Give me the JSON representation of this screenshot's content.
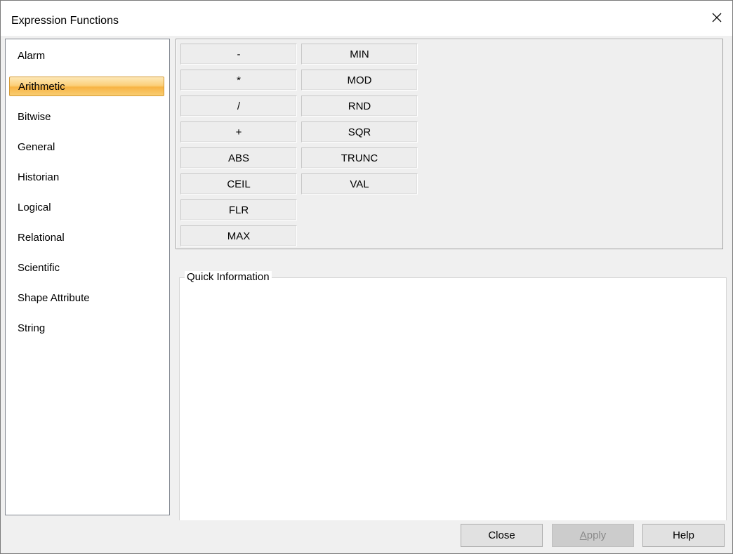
{
  "window": {
    "title": "Expression Functions",
    "close_icon": "close-icon"
  },
  "categories": {
    "items": [
      {
        "label": "Alarm",
        "selected": false
      },
      {
        "label": "Arithmetic",
        "selected": true
      },
      {
        "label": "Bitwise",
        "selected": false
      },
      {
        "label": "General",
        "selected": false
      },
      {
        "label": "Historian",
        "selected": false
      },
      {
        "label": "Logical",
        "selected": false
      },
      {
        "label": "Relational",
        "selected": false
      },
      {
        "label": "Scientific",
        "selected": false
      },
      {
        "label": "Shape Attribute",
        "selected": false
      },
      {
        "label": "String",
        "selected": false
      }
    ]
  },
  "functions": {
    "column1": [
      "-",
      "*",
      "/",
      "+",
      "ABS",
      "CEIL",
      "FLR",
      "MAX"
    ],
    "column2": [
      "MIN",
      "MOD",
      "RND",
      "SQR",
      "TRUNC",
      "VAL"
    ]
  },
  "quick_info": {
    "legend": "Quick Information",
    "content": ""
  },
  "buttons": {
    "close": "Close",
    "apply": "Apply",
    "help": "Help"
  },
  "colors": {
    "selected_gradient_top": "#fde8b8",
    "selected_gradient_bottom": "#f7b445",
    "panel_bg": "#efefef",
    "window_bg": "#f0f0f0"
  }
}
